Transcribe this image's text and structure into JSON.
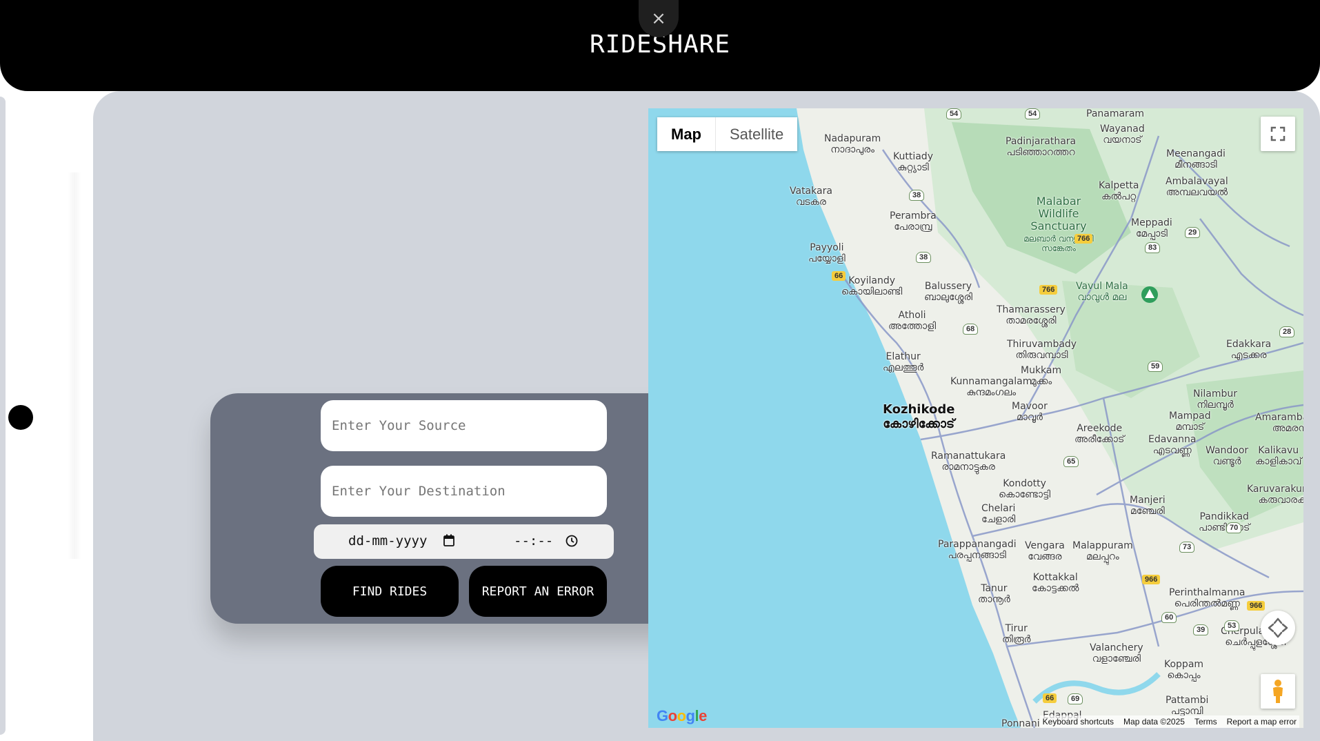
{
  "header": {
    "brand": "RIDESHARE",
    "close_symbol": "×"
  },
  "form": {
    "source_placeholder": "Enter Your Source",
    "destination_placeholder": "Enter Your Destination",
    "date_value": "dd-mm-yyyy",
    "time_value": "--:--",
    "find_button": "FIND RIDES",
    "report_button": "REPORT AN ERROR"
  },
  "map": {
    "type_map": "Map",
    "type_satellite": "Satellite",
    "logo": "Google",
    "attribution": {
      "keyboard": "Keyboard shortcuts",
      "data": "Map data ©2025",
      "terms": "Terms",
      "report": "Report a map error"
    },
    "places": [
      {
        "name": "Nadapuram",
        "local": "നാദാപുരം"
      },
      {
        "name": "Kuttiady",
        "local": "കുറ്റ്യാടി"
      },
      {
        "name": "Padinjarathara",
        "local": "പടിഞ്ഞാറത്തറ"
      },
      {
        "name": "Panamaram",
        "local": ""
      },
      {
        "name": "Wayanad",
        "local": "വയനാട്"
      },
      {
        "name": "Meenangadi",
        "local": "മീനങ്ങാടി"
      },
      {
        "name": "Vatakara",
        "local": "വടകര"
      },
      {
        "name": "Kalpetta",
        "local": "കൽപറ്റ"
      },
      {
        "name": "Ambalavayal",
        "local": "അമ്പലവയൽ"
      },
      {
        "name": "Malabar Wildlife Sanctuary",
        "local": "മലബാർ വന്യജീവി സങ്കേതം"
      },
      {
        "name": "Perambra",
        "local": "പേരാമ്പ്ര"
      },
      {
        "name": "Meppadi",
        "local": "മേപ്പാടി"
      },
      {
        "name": "Payyoli",
        "local": "പയ്യോളി"
      },
      {
        "name": "Vavul Mala",
        "local": "വാവുൾ മല"
      },
      {
        "name": "Koyilandy",
        "local": "കൊയിലാണ്ടി"
      },
      {
        "name": "Balussery",
        "local": "ബാലുശ്ശേരി"
      },
      {
        "name": "Thamarassery",
        "local": "താമരശ്ശേരി"
      },
      {
        "name": "Atholi",
        "local": "അത്തോളി"
      },
      {
        "name": "Thiruvambady",
        "local": "തിരുവമ്പാടി"
      },
      {
        "name": "Edakkara",
        "local": "എടക്കര"
      },
      {
        "name": "Elathur",
        "local": "എലത്തൂർ"
      },
      {
        "name": "Mukkam",
        "local": "മുക്കം"
      },
      {
        "name": "Kunnamangalam",
        "local": "കുന്ദമംഗലം"
      },
      {
        "name": "Nilambur",
        "local": "നിലമ്പൂർ"
      },
      {
        "name": "Kozhikode",
        "local": "കോഴിക്കോട്"
      },
      {
        "name": "Mavoor",
        "local": "മാവൂർ"
      },
      {
        "name": "Mampad",
        "local": "മമ്പാട്"
      },
      {
        "name": "Amarambalam",
        "local": "അമരമ്പ"
      },
      {
        "name": "Areekode",
        "local": "അരീക്കോട്"
      },
      {
        "name": "Edavanna",
        "local": "എടവണ്ണ"
      },
      {
        "name": "Wandoor",
        "local": "വണ്ടൂർ"
      },
      {
        "name": "Kalikavu",
        "local": "കാളികാവ്"
      },
      {
        "name": "Ramanattukara",
        "local": "രാമനാട്ടുകര"
      },
      {
        "name": "Kondotty",
        "local": "കൊണ്ടോട്ടി"
      },
      {
        "name": "Karuvarakundu",
        "local": "കരുവാരക്കു"
      },
      {
        "name": "Manjeri",
        "local": "മഞ്ചേരി"
      },
      {
        "name": "Chelari",
        "local": "ചേളാരി"
      },
      {
        "name": "Pandikkad",
        "local": "പാണ്ടിക്കാട്"
      },
      {
        "name": "Parappanangadi",
        "local": "പരപ്പനങ്ങാടി"
      },
      {
        "name": "Vengara",
        "local": "വേങ്ങര"
      },
      {
        "name": "Malappuram",
        "local": "മലപ്പുറം"
      },
      {
        "name": "Kottakkal",
        "local": "കോട്ടക്കൽ"
      },
      {
        "name": "Tanur",
        "local": "താനൂർ"
      },
      {
        "name": "Perinthalmanna",
        "local": "പെരിന്തൽമണ്ണ"
      },
      {
        "name": "Tirur",
        "local": "തിരൂർ"
      },
      {
        "name": "Valanchery",
        "local": "വളാഞ്ചേരി"
      },
      {
        "name": "Cherpulassery",
        "local": "ചെർപ്പുളശ്ശേരി"
      },
      {
        "name": "Koppam",
        "local": "കൊപ്പം"
      },
      {
        "name": "Pattambi",
        "local": "പട്ടാമ്പി"
      },
      {
        "name": "Edappal",
        "local": ""
      },
      {
        "name": "Ponnani",
        "local": ""
      }
    ],
    "routes": [
      "54",
      "54",
      "38",
      "38",
      "766",
      "766",
      "66",
      "29",
      "83",
      "68",
      "59",
      "28",
      "65",
      "70",
      "73",
      "966",
      "966",
      "60",
      "39",
      "53",
      "66",
      "69"
    ]
  }
}
